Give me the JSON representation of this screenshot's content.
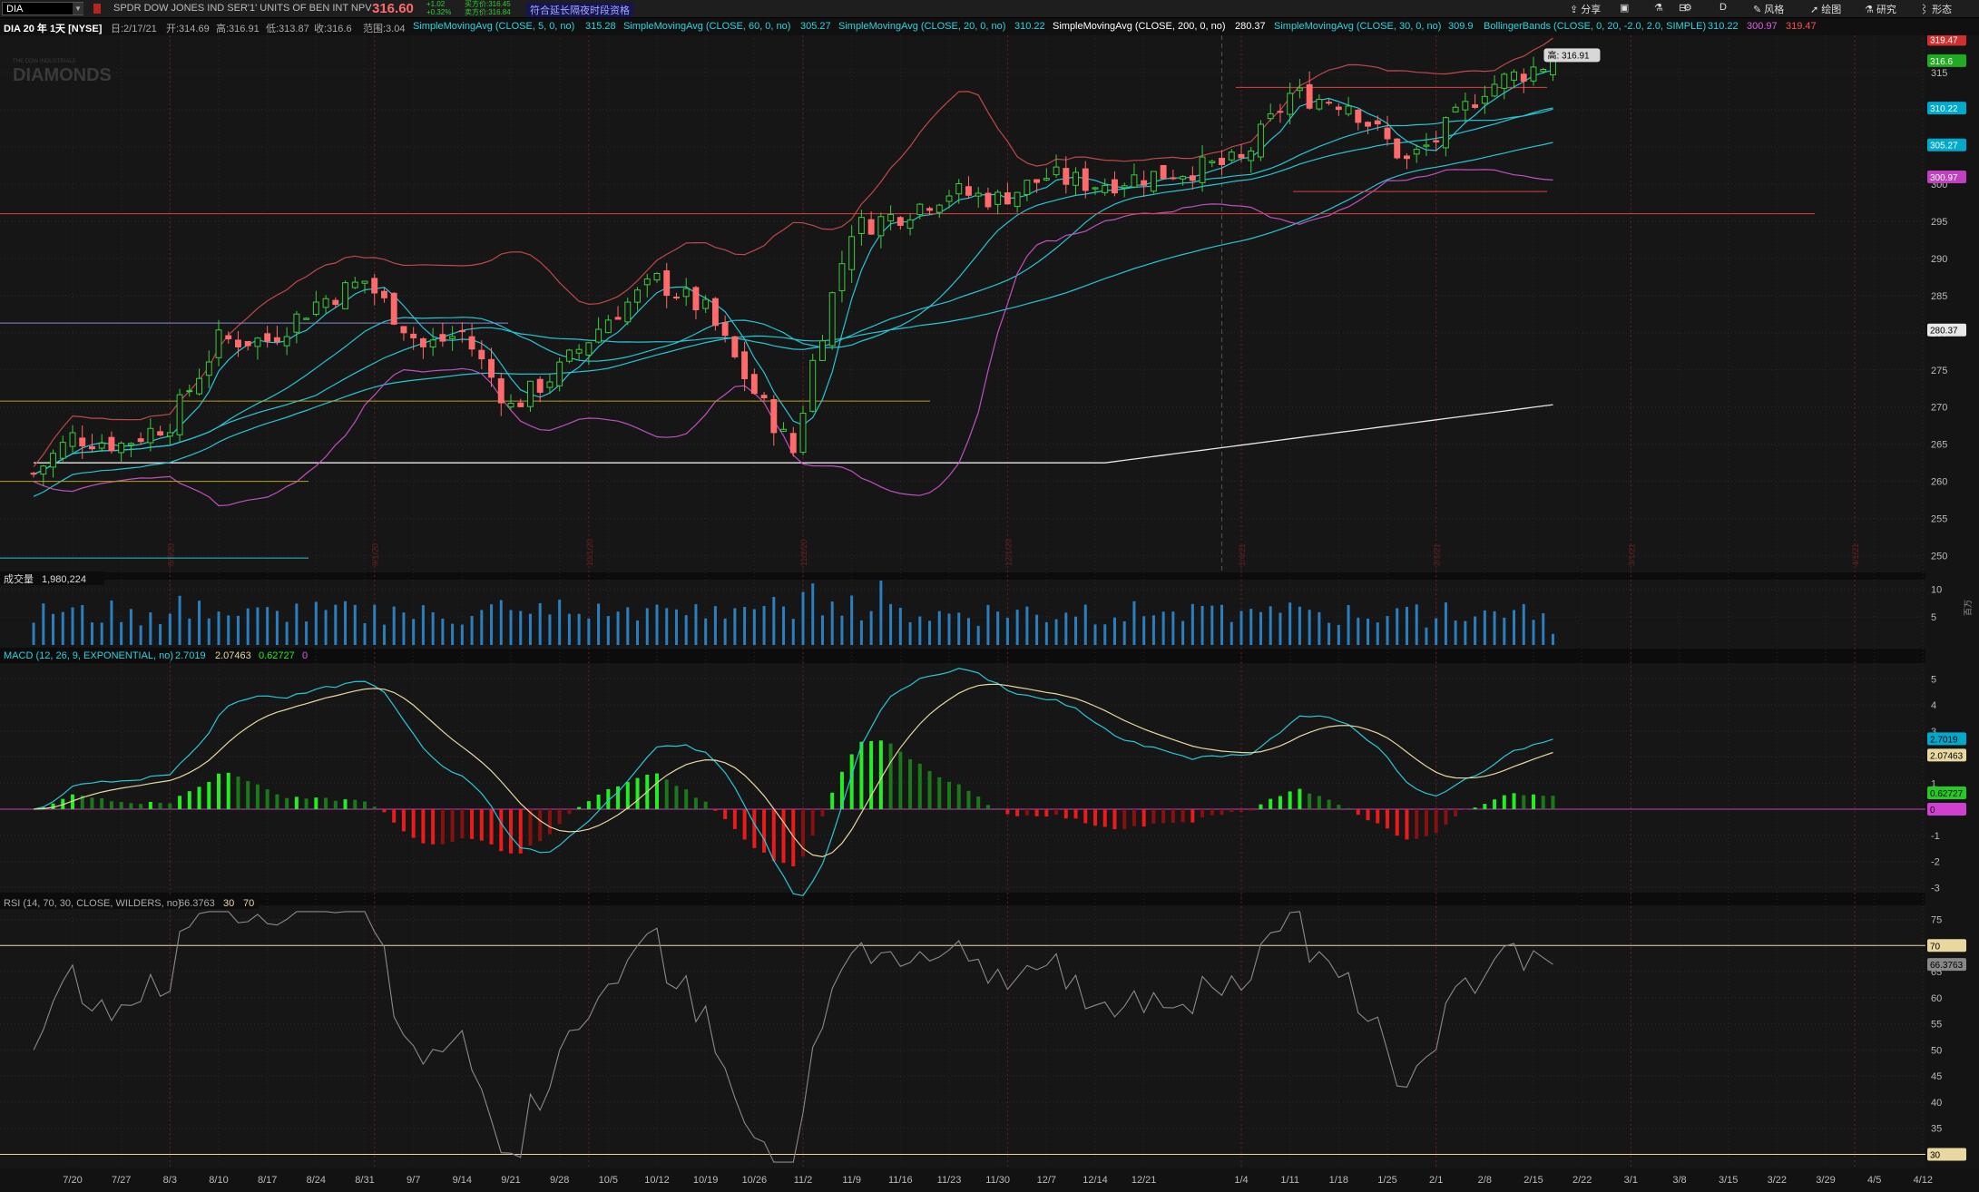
{
  "toolbar": {
    "symbol": "DIA",
    "description": "SPDR DOW JONES IND SER'1' UNITS OF BEN INT NPV",
    "last_price": "316.60",
    "change": "+1.02",
    "change_pct": "+0.32%",
    "bid": "买方价:316.45",
    "ask": "卖方价:316.84",
    "extended_hours": "符合延长隔夜时段资格",
    "share": "分享",
    "style": "风格",
    "draw": "绘图",
    "research": "研究",
    "form": "形态",
    "period": "D",
    "colors": {
      "accent_red": "#ff6a6a",
      "up": "#33cc33",
      "bg": "#141414"
    }
  },
  "header": {
    "title": "DIA 20 年 1天 [NYSE]",
    "date": "日:2/17/21",
    "open": "开:314.69",
    "high": "高:316.91",
    "low": "低:313.87",
    "close": "收:316.6",
    "range": "范围:3.04",
    "studies": [
      {
        "name": "SimpleMovingAvg (CLOSE, 5, 0, no)",
        "value": "315.28",
        "color": "#2ad4e0"
      },
      {
        "name": "SimpleMovingAvg (CLOSE, 60, 0, no)",
        "value": "305.27",
        "color": "#2ad4e0"
      },
      {
        "name": "SimpleMovingAvg (CLOSE, 20, 0, no)",
        "value": "310.22",
        "color": "#2ad4e0"
      },
      {
        "name": "SimpleMovingAvg (CLOSE, 200, 0, no)",
        "value": "280.37",
        "color": "#ffffff"
      },
      {
        "name": "SimpleMovingAvg (CLOSE, 30, 0, no)",
        "value": "309.9",
        "color": "#2ad4e0"
      },
      {
        "name": "BollingerBands (CLOSE, 0, 20, -2.0, 2.0, SIMPLE)",
        "value": "310.22",
        "color": "#2ad4e0"
      }
    ],
    "bb_lower": "300.97",
    "bb_upper": "319.47"
  },
  "watermark": {
    "line1": "THE DOW INDUSTRIALS",
    "line2": "DIAMONDS"
  },
  "price_pane": {
    "high_marker": "高: 316.91",
    "y_ticks": [
      "315",
      "310",
      "305",
      "300",
      "295",
      "290",
      "285",
      "280",
      "275",
      "270",
      "265",
      "260",
      "255",
      "250"
    ],
    "right_badges": [
      {
        "text": "319.47",
        "bg": "#d03030",
        "fg": "#ffffff"
      },
      {
        "text": "316.6",
        "bg": "#22aa22",
        "fg": "#ffffff"
      },
      {
        "text": "310.22",
        "bg": "#00aacc",
        "fg": "#ffffff"
      },
      {
        "text": "305.27",
        "bg": "#00aacc",
        "fg": "#ffffff"
      },
      {
        "text": "300.97",
        "bg": "#c040c0",
        "fg": "#ffffff"
      },
      {
        "text": "280.37",
        "bg": "#e8e8e8",
        "fg": "#000000"
      }
    ],
    "vertical_date_labels": [
      "8/3/20",
      "9/1/20",
      "10/1/20",
      "11/2/20",
      "12/1/20",
      "1/4/21",
      "2/1/21",
      "3/1/21",
      "4/1/21"
    ]
  },
  "volume_pane": {
    "label": "成交量",
    "value": "1,980,224",
    "y_ticks": [
      "10",
      "5"
    ],
    "unit": "百万"
  },
  "macd_pane": {
    "label": "MACD (12, 26, 9, EXPONENTIAL, no)",
    "value": "2.7019",
    "avg": "2.07463",
    "diff": "0.62727",
    "zero": "0",
    "y_ticks": [
      "5",
      "4",
      "3",
      "2",
      "1",
      "-1",
      "-2",
      "-3"
    ],
    "badges": [
      {
        "text": "2.7019",
        "bg": "#00aacc"
      },
      {
        "text": "2.07463",
        "bg": "#e8d8a0"
      },
      {
        "text": "0.62727",
        "bg": "#22cc22"
      },
      {
        "text": "0",
        "bg": "#d040d0"
      }
    ]
  },
  "rsi_pane": {
    "label": "RSI (14, 70, 30, CLOSE, WILDERS, no)",
    "value": "66.3763",
    "ob": "30",
    "os": "70",
    "y_ticks": [
      "75",
      "70",
      "65",
      "60",
      "55",
      "50",
      "45",
      "40",
      "35",
      "30"
    ],
    "badges": [
      {
        "text": "70",
        "bg": "#e8d8a0"
      },
      {
        "text": "66.3763",
        "bg": "#888888"
      },
      {
        "text": "30",
        "bg": "#e8d8a0"
      }
    ]
  },
  "x_axis": [
    "7/20",
    "7/27",
    "8/3",
    "8/10",
    "8/17",
    "8/24",
    "8/31",
    "9/7",
    "9/14",
    "9/21",
    "9/28",
    "10/5",
    "10/12",
    "10/19",
    "10/26",
    "11/2",
    "11/9",
    "11/16",
    "11/23",
    "11/30",
    "12/7",
    "12/14",
    "12/21",
    "1/4",
    "1/11",
    "1/18",
    "1/25",
    "2/1",
    "2/8",
    "2/15",
    "2/22",
    "3/1",
    "3/8",
    "3/15",
    "3/22",
    "3/29",
    "4/5",
    "4/12"
  ],
  "chart_data": [
    {
      "type": "candlestick",
      "title": "DIA 20 年 1天 [NYSE]",
      "x_range": [
        "7/13/20",
        "4/12/21"
      ],
      "ylim": [
        248,
        320
      ],
      "ohlc_close_approx": [
        [
          "7/14",
          261
        ],
        [
          "7/20",
          266
        ],
        [
          "7/27",
          265
        ],
        [
          "8/3",
          268
        ],
        [
          "8/10",
          279
        ],
        [
          "8/17",
          279
        ],
        [
          "8/24",
          284
        ],
        [
          "8/31",
          287
        ],
        [
          "9/8",
          278
        ],
        [
          "9/14",
          280
        ],
        [
          "9/21",
          270
        ],
        [
          "9/28",
          275
        ],
        [
          "10/5",
          282
        ],
        [
          "10/12",
          287
        ],
        [
          "10/19",
          283
        ],
        [
          "10/26",
          272
        ],
        [
          "10/30",
          264
        ],
        [
          "11/3",
          276
        ],
        [
          "11/9",
          294
        ],
        [
          "11/16",
          296
        ],
        [
          "11/23",
          299
        ],
        [
          "11/30",
          298
        ],
        [
          "12/7",
          301
        ],
        [
          "12/14",
          300
        ],
        [
          "12/21",
          301
        ],
        [
          "1/4",
          303
        ],
        [
          "1/11",
          312
        ],
        [
          "1/19",
          311
        ],
        [
          "1/27",
          303
        ],
        [
          "2/1",
          306
        ],
        [
          "2/8",
          313
        ],
        [
          "2/17",
          316.6
        ]
      ],
      "last": {
        "date": "2/17/21",
        "open": 314.69,
        "high": 316.91,
        "low": 313.87,
        "close": 316.6
      }
    },
    {
      "type": "bar",
      "title": "成交量",
      "ylim": [
        0,
        12
      ],
      "unit": "百万",
      "last_value": 1.98
    },
    {
      "type": "line",
      "title": "MACD (12, 26, 9, EXPONENTIAL, no)",
      "ylim": [
        -3,
        5.5
      ],
      "last": {
        "value": 2.7019,
        "avg": 2.07463,
        "diff": 0.62727
      }
    },
    {
      "type": "line",
      "title": "RSI (14, 70, 30, CLOSE, WILDERS, no)",
      "ylim": [
        28,
        77
      ],
      "last_value": 66.3763,
      "levels": [
        70,
        30
      ]
    }
  ]
}
